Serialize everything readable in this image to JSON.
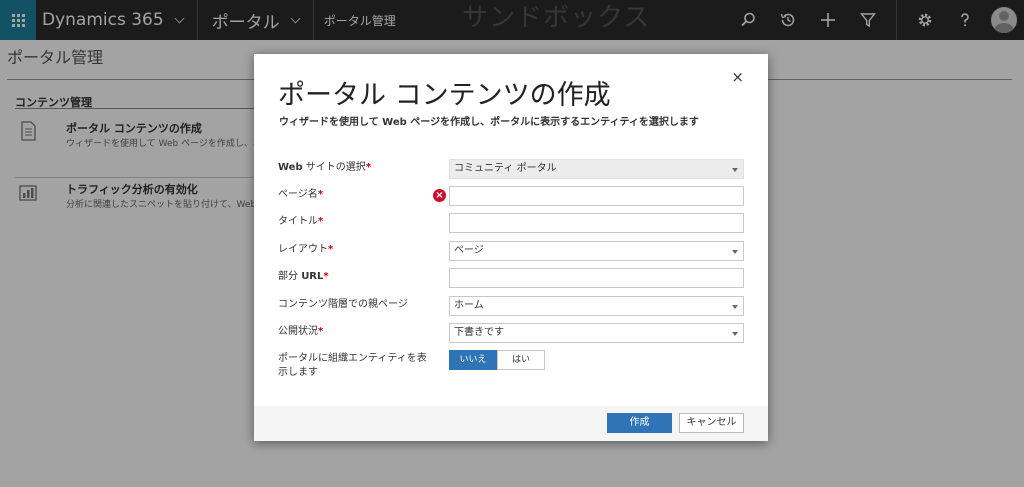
{
  "topbar": {
    "app_name": "Dynamics 365",
    "area": "ポータル",
    "breadcrumb": "ポータル管理",
    "environment": "サンドボックス"
  },
  "page": {
    "title": "ポータル管理",
    "section_title": "コンテンツ管理",
    "items": [
      {
        "title": "ポータル コンテンツの作成",
        "description": "ウィザードを使用して Web ページを作成し、ポータ"
      },
      {
        "title": "トラフィック分析の有効化",
        "description": "分析に関連したスニペットを貼り付けて、Web サイ"
      }
    ]
  },
  "dialog": {
    "title": "ポータル コンテンツの作成",
    "subtitle": "ウィザードを使用して Web ページを作成し、ポータルに表示するエンティティを選択します",
    "close_label": "×",
    "fields": {
      "website": {
        "label_bold": "Web",
        "label": " サイトの選択",
        "value": "コミュニティ ポータル"
      },
      "page_name": {
        "label": "ページ名",
        "value": ""
      },
      "title": {
        "label": "タイトル",
        "value": ""
      },
      "layout": {
        "label": "レイアウト",
        "value": "ページ"
      },
      "partial_url": {
        "label": "部分 ",
        "label_bold": "URL",
        "value": ""
      },
      "parent_page": {
        "label": "コンテンツ階層での親ページ",
        "value": "ホーム"
      },
      "publish_state": {
        "label": "公開状況",
        "value": "下書きです"
      },
      "show_entity": {
        "label_line1": "ポータルに組織エンティティを表",
        "label_line2": "示します",
        "option_no": "いいえ",
        "option_yes": "はい"
      }
    },
    "required_mark": "*",
    "buttons": {
      "create": "作成",
      "cancel": "キャンセル"
    }
  },
  "colors": {
    "accent": "#2f74b6",
    "topbar": "#2b2b2b",
    "waffle": "#1f7f9e",
    "error": "#c8102e",
    "required": "#cc0000"
  }
}
